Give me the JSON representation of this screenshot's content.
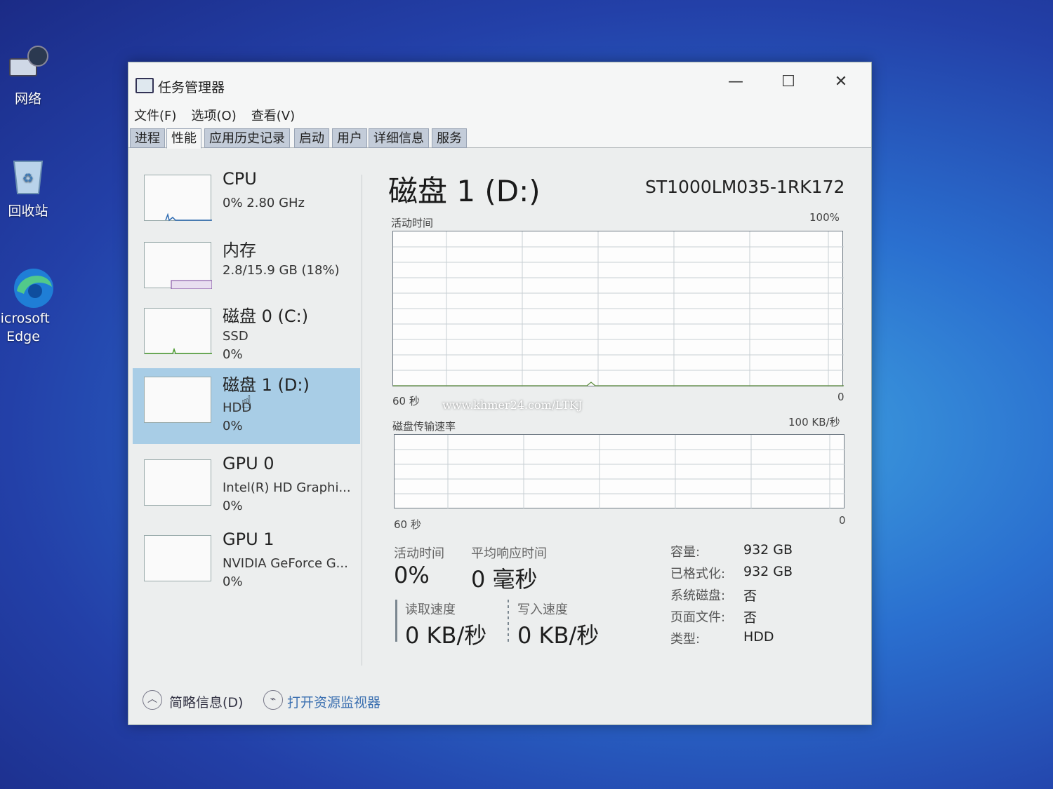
{
  "desktop": {
    "icons": [
      {
        "label": "网络"
      },
      {
        "label": "回收站"
      },
      {
        "label": "licrosoft\nEdge"
      }
    ],
    "watermark": "www.khmer24.com/LTKJ"
  },
  "window": {
    "title": "任务管理器",
    "controls": {
      "minimize": "—",
      "maximize": "☐",
      "close": "✕"
    },
    "menu": [
      "文件(F)",
      "选项(O)",
      "查看(V)"
    ],
    "tabs": [
      "进程",
      "性能",
      "应用历史记录",
      "启动",
      "用户",
      "详细信息",
      "服务"
    ],
    "active_tab": "性能"
  },
  "sidebar": {
    "items": [
      {
        "name": "CPU",
        "sub1": "0% 2.80 GHz",
        "sub2": ""
      },
      {
        "name": "内存",
        "sub1": "2.8/15.9 GB (18%)",
        "sub2": ""
      },
      {
        "name": "磁盘 0 (C:)",
        "sub1": "SSD",
        "sub2": "0%"
      },
      {
        "name": "磁盘 1 (D:)",
        "sub1": "HDD",
        "sub2": "0%"
      },
      {
        "name": "GPU 0",
        "sub1": "Intel(R) HD Graphi...",
        "sub2": "0%"
      },
      {
        "name": "GPU 1",
        "sub1": "NVIDIA GeForce G...",
        "sub2": "0%"
      }
    ],
    "selected_index": 3
  },
  "main": {
    "title": "磁盘 1 (D:)",
    "model": "ST1000LM035-1RK172",
    "chart1": {
      "label": "活动时间",
      "max": "100%",
      "time": "60 秒",
      "min": "0"
    },
    "chart2": {
      "label": "磁盘传输速率",
      "max": "100 KB/秒",
      "time": "60 秒",
      "min": "0"
    },
    "stats": {
      "active_label": "活动时间",
      "active_value": "0%",
      "resp_label": "平均响应时间",
      "resp_value": "0 毫秒",
      "read_label": "读取速度",
      "read_value": "0 KB/秒",
      "write_label": "写入速度",
      "write_value": "0 KB/秒"
    },
    "props": [
      {
        "key": "容量:",
        "value": "932 GB"
      },
      {
        "key": "已格式化:",
        "value": "932 GB"
      },
      {
        "key": "系统磁盘:",
        "value": "否"
      },
      {
        "key": "页面文件:",
        "value": "否"
      },
      {
        "key": "类型:",
        "value": "HDD"
      }
    ]
  },
  "footer": {
    "summary": "简略信息(D)",
    "resource_monitor": "打开资源监视器"
  },
  "colors": {
    "accent_selected": "#a8cde6",
    "tab_bg": "#c3ccd9",
    "graph_border": "#6f7a84"
  }
}
